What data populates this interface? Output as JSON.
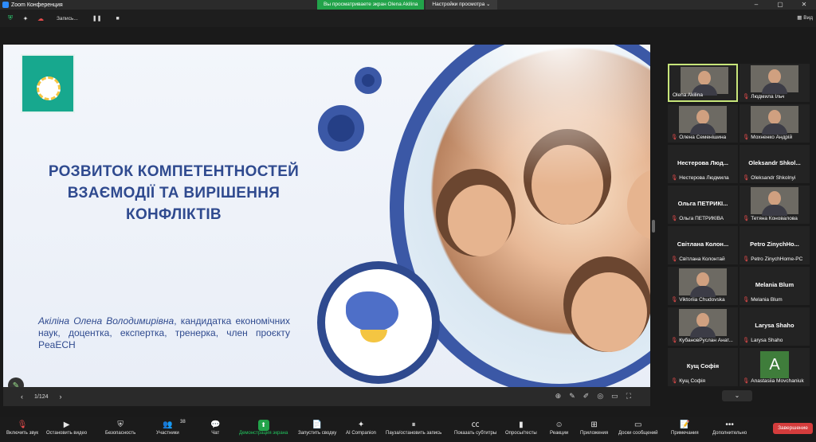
{
  "titlebar": {
    "title": "Zoom Конференция"
  },
  "share": {
    "viewing_label": "Вы просматриваете экран Olena Akilina",
    "options_label": "Настройки просмотра"
  },
  "top_toolbar": {
    "recording_label": "Запись...",
    "view_label": "Вид"
  },
  "slide": {
    "title_lines": [
      "РОЗВИТОК КОМПЕТЕНТНОСТЕЙ",
      "ВЗАЄМОДІЇ ТА ВИРІШЕННЯ",
      "КОНФЛІКТІВ"
    ],
    "author_name": "Акіліна Олена Володимирівна",
    "author_rest": ", кандидатка економічних наук, доцентка, експертка, тренерка, член проєкту PeaECH"
  },
  "slide_nav": {
    "page": "1/124"
  },
  "participants": [
    {
      "name": "Olena Akilina",
      "video": true,
      "active": true
    },
    {
      "name": "Людмила Ільч",
      "video": true,
      "muted": true
    },
    {
      "name": "Олена Семенішина",
      "video": true,
      "muted": true
    },
    {
      "name": "Мохненко Андрій",
      "video": true,
      "muted": true
    },
    {
      "big": "Нестерова Люд...",
      "name": "Нестерова Людмила",
      "muted": true
    },
    {
      "big": "Oleksandr Shkol...",
      "name": "Oleksandr Shkolnyi",
      "muted": true
    },
    {
      "big": "Ольга ПЕТРИКІ...",
      "name": "Ольга ПЕТРИКІВА",
      "muted": true
    },
    {
      "name": "Тетяна Коновалова",
      "video": true,
      "muted": true
    },
    {
      "big": "Світлана Колон...",
      "name": "Світлана Колонтай",
      "muted": true
    },
    {
      "big": "Petro ZinychHo...",
      "name": "Petro ZinychHome-PC",
      "muted": true
    },
    {
      "name": "Viktoriia Chudovska",
      "video": true,
      "muted": true
    },
    {
      "big": "Melania Blum",
      "name": "Melania Blum",
      "muted": true
    },
    {
      "name": "КубановРуслан Анат...",
      "video": true,
      "muted": true
    },
    {
      "big": "Larysa Shaho",
      "name": "Larysa Shaho",
      "muted": true
    },
    {
      "big": "Кущ Софія",
      "name": "Кущ Софія",
      "muted": true
    },
    {
      "avatar": "A",
      "name": "Anastasiia Movchaniuk",
      "muted": true
    }
  ],
  "bottom": {
    "unmute": "Включить звук",
    "video": "Остановить видео",
    "security": "Безопасность",
    "participants": "Участники",
    "participants_count": "38",
    "chat": "Чат",
    "share": "Демонстрация экрана",
    "summary": "Запустить сводку",
    "ai": "AI Companion",
    "record": "Пауза/остановить запись",
    "captions": "Показать субтитры",
    "polls": "Опросы/тесты",
    "reactions": "Реакции",
    "apps": "Приложения",
    "whiteboards": "Доски сообщений",
    "notes": "Примечания",
    "more": "Дополнительно",
    "end": "Завершение"
  }
}
